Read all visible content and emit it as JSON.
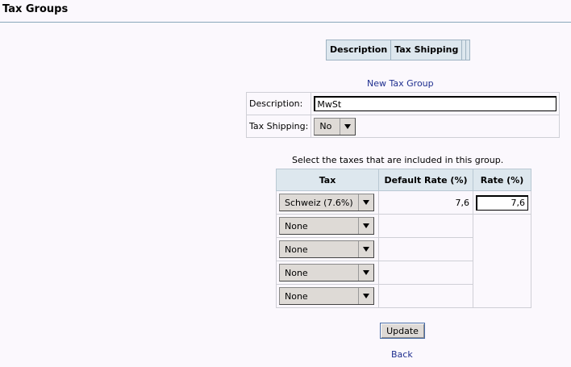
{
  "page": {
    "title": "Tax Groups"
  },
  "list_header": {
    "columns": [
      "Description",
      "Tax Shipping"
    ]
  },
  "new_group": {
    "link_label": "New Tax Group",
    "description_label": "Description:",
    "description_value": "MwSt",
    "tax_shipping_label": "Tax Shipping:",
    "tax_shipping_value": "No"
  },
  "taxes": {
    "caption": "Select the taxes that are included in this group.",
    "headers": {
      "tax": "Tax",
      "default_rate": "Default Rate (%)",
      "rate": "Rate (%)"
    },
    "rows": [
      {
        "tax": "Schweiz (7.6%)",
        "default_rate": "7,6",
        "rate": "7,6"
      },
      {
        "tax": "None",
        "default_rate": "",
        "rate": ""
      },
      {
        "tax": "None",
        "default_rate": "",
        "rate": ""
      },
      {
        "tax": "None",
        "default_rate": "",
        "rate": ""
      },
      {
        "tax": "None",
        "default_rate": "",
        "rate": ""
      }
    ]
  },
  "actions": {
    "update_label": "Update",
    "back_label": "Back"
  }
}
